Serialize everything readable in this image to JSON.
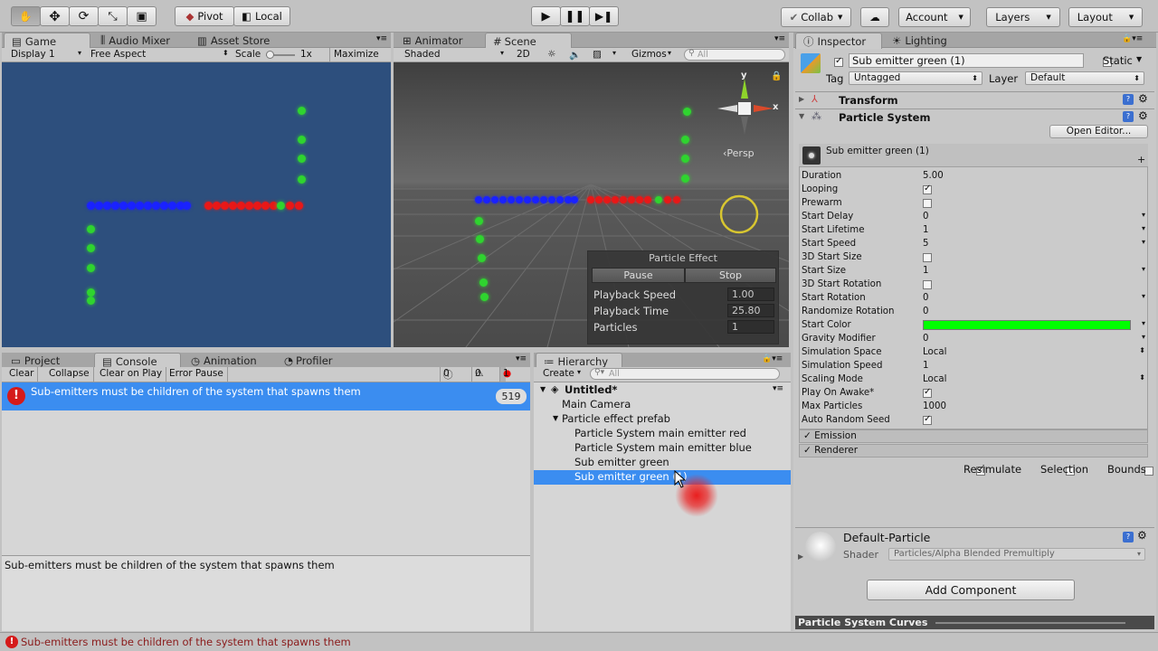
{
  "toolbar": {
    "pivot": "Pivot",
    "local": "Local",
    "collab": "Collab",
    "account": "Account",
    "layers": "Layers",
    "layout": "Layout"
  },
  "game": {
    "tabs": [
      "Game",
      "Audio Mixer",
      "Asset Store"
    ],
    "display": "Display 1",
    "aspect": "Free Aspect",
    "scale_label": "Scale",
    "scale_value": "1x",
    "maximize": "Maximize On"
  },
  "scene": {
    "tabs": [
      "Animator",
      "Scene"
    ],
    "shading": "Shaded",
    "mode2d": "2D",
    "gizmos": "Gizmos",
    "search_placeholder": "All",
    "persp": "Persp",
    "axis_y": "y",
    "axis_x": "x",
    "particle_effect": {
      "title": "Particle Effect",
      "pause": "Pause",
      "stop": "Stop",
      "rows": [
        {
          "label": "Playback Speed",
          "value": "1.00"
        },
        {
          "label": "Playback Time",
          "value": "25.80"
        },
        {
          "label": "Particles",
          "value": "1"
        }
      ]
    }
  },
  "console": {
    "tabs": [
      "Project",
      "Console",
      "Animation",
      "Profiler"
    ],
    "buttons": [
      "Clear",
      "Collapse",
      "Clear on Play",
      "Error Pause"
    ],
    "counts": {
      "info": "0",
      "warn": "0",
      "error": "1"
    },
    "message": "Sub-emitters must be children of the system that spawns them",
    "message_count": "519",
    "detail": "Sub-emitters must be children of the system that spawns them"
  },
  "hierarchy": {
    "tab": "Hierarchy",
    "create": "Create",
    "search_placeholder": "All",
    "scene_name": "Untitled*",
    "items": [
      "Main Camera",
      "Particle effect prefab",
      "Particle System main emitter red",
      "Particle System main emitter blue",
      "Sub emitter green",
      "Sub emitter green (1)"
    ]
  },
  "inspector": {
    "tabs": [
      "Inspector",
      "Lighting"
    ],
    "object_name": "Sub emitter green (1)",
    "static_label": "Static",
    "tag_label": "Tag",
    "tag_value": "Untagged",
    "layer_label": "Layer",
    "layer_value": "Default",
    "components": [
      "Transform",
      "Particle System"
    ],
    "open_editor": "Open Editor...",
    "ps_name": "Sub emitter green (1)",
    "properties": [
      {
        "label": "Duration",
        "value": "5.00"
      },
      {
        "label": "Looping",
        "value": ""
      },
      {
        "label": "Prewarm",
        "value": ""
      },
      {
        "label": "Start Delay",
        "value": "0"
      },
      {
        "label": "Start Lifetime",
        "value": "1"
      },
      {
        "label": "Start Speed",
        "value": "5"
      },
      {
        "label": "3D Start Size",
        "value": ""
      },
      {
        "label": "Start Size",
        "value": "1"
      },
      {
        "label": "3D Start Rotation",
        "value": ""
      },
      {
        "label": "Start Rotation",
        "value": "0"
      },
      {
        "label": "Randomize Rotation",
        "value": "0"
      },
      {
        "label": "Start Color",
        "value": ""
      },
      {
        "label": "Gravity Modifier",
        "value": "0"
      },
      {
        "label": "Simulation Space",
        "value": "Local"
      },
      {
        "label": "Simulation Speed",
        "value": "1"
      },
      {
        "label": "Scaling Mode",
        "value": "Local"
      },
      {
        "label": "Play On Awake*",
        "value": ""
      },
      {
        "label": "Max Particles",
        "value": "1000"
      },
      {
        "label": "Auto Random Seed",
        "value": ""
      }
    ],
    "modules": [
      "Emission",
      "Renderer"
    ],
    "resimulate": "Resimulate",
    "selection": "Selection",
    "bounds": "Bounds",
    "material_name": "Default-Particle",
    "shader_label": "Shader",
    "shader_value": "Particles/Alpha Blended Premultiply",
    "add_component": "Add Component",
    "curves": "Particle System Curves"
  },
  "status": {
    "message": "Sub-emitters must be children of the system that spawns them"
  },
  "colors": {
    "selection": "#3b8df0",
    "start_color": "#00ff00",
    "game_bg": "#2d4f7d",
    "scene_bg": "#474747"
  }
}
